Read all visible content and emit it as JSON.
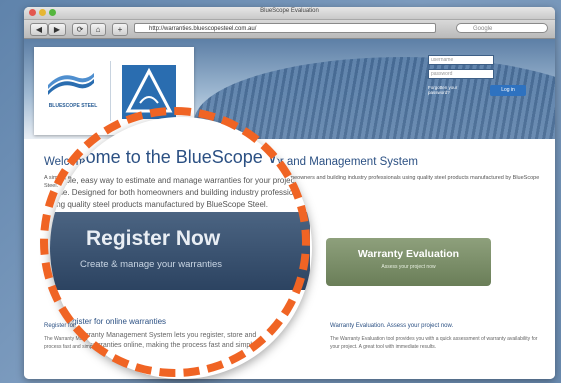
{
  "window": {
    "title": "BlueScope Evaluation"
  },
  "toolbar": {
    "back_label": "◀",
    "forward_label": "▶",
    "reload_label": "⟳",
    "home_label": "⌂",
    "bookmark_label": "+",
    "url": "http://warranties.bluescopesteel.com.au/",
    "search_placeholder": "Google"
  },
  "header": {
    "logo_text": "BLUESCOPE STEEL",
    "login": {
      "username_placeholder": "username",
      "password_placeholder": "password",
      "forgot_label": "Forgotten your password?",
      "login_label": "Log in"
    }
  },
  "main": {
    "headline": "Welcome to the BlueScope Warranty Estimator and Management System",
    "intro": "A simple, easy way to estimate and manage warranties for your projects online. Designed for both homeowners and building industry professionals using quality steel products manufactured by BlueScope Steel.",
    "register": {
      "title": "Register Now",
      "subtitle": "Create & manage your warranties"
    },
    "evaluation": {
      "title": "Warranty Evaluation",
      "subtitle": "Assess your project now"
    },
    "left_section": {
      "title": "Register for online warranties",
      "text": "The Warranty Management System lets you register, store and manage warranties online, making the process fast and simple."
    },
    "right_section": {
      "title": "Warranty Evaluation. Assess your project now.",
      "text": "The Warranty Evaluation tool provides you with a quick assessment of warranty availability for your project. A great tool with immediate results."
    }
  }
}
